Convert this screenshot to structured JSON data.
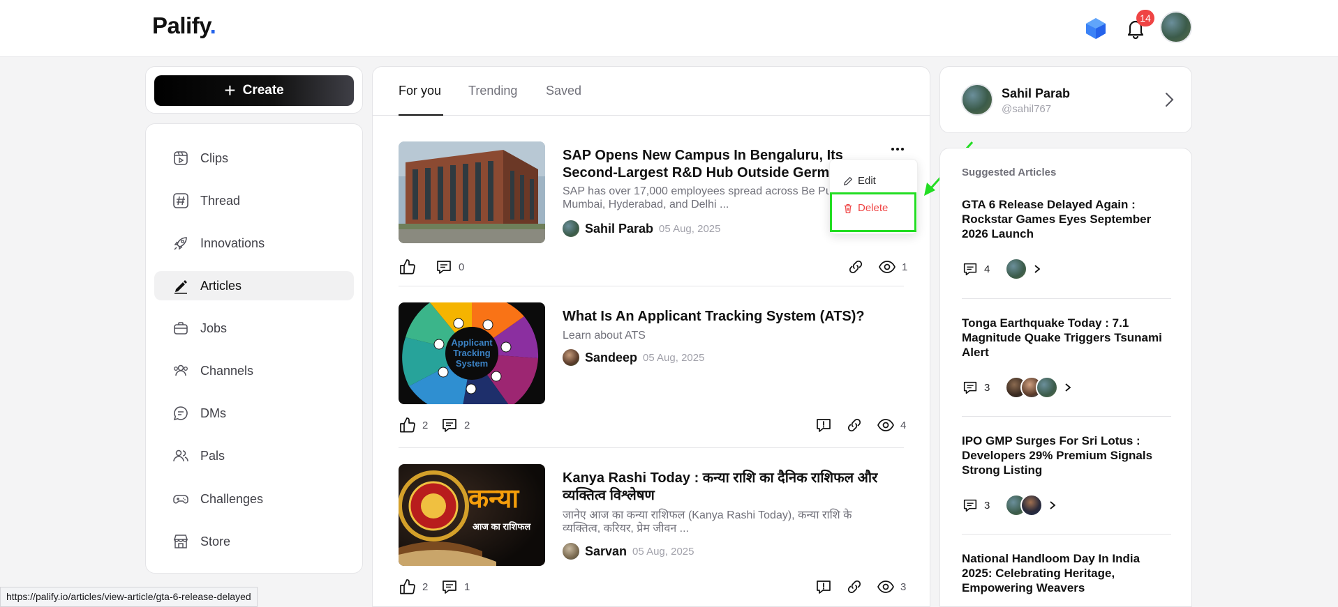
{
  "header": {
    "logo_text": "Palify",
    "logo_dot": ".",
    "notification_count": "14",
    "accent_color": "#2563eb"
  },
  "sidebar": {
    "create_label": "Create",
    "items": [
      {
        "label": "Clips",
        "icon": "clips-icon"
      },
      {
        "label": "Thread",
        "icon": "hash-icon"
      },
      {
        "label": "Innovations",
        "icon": "rocket-icon"
      },
      {
        "label": "Articles",
        "icon": "pen-icon",
        "active": true
      },
      {
        "label": "Jobs",
        "icon": "briefcase-icon"
      },
      {
        "label": "Channels",
        "icon": "users-icon"
      },
      {
        "label": "DMs",
        "icon": "chat-icon"
      },
      {
        "label": "Pals",
        "icon": "pals-icon"
      },
      {
        "label": "Challenges",
        "icon": "gamepad-icon"
      },
      {
        "label": "Store",
        "icon": "store-icon"
      }
    ]
  },
  "feed": {
    "tabs": [
      {
        "label": "For you",
        "active": true
      },
      {
        "label": "Trending"
      },
      {
        "label": "Saved"
      }
    ],
    "articles": [
      {
        "title": "SAP Opens New Campus In Bengaluru, Its Second-Largest R&D Hub Outside Germ",
        "description": "SAP has over 17,000 employees spread across Be Pune, Mumbai, Hyderabad, and Delhi ...",
        "author": "Sahil Parab",
        "date": "05 Aug, 2025",
        "likes": "",
        "comments": "0",
        "views": "1"
      },
      {
        "title": "What Is An Applicant Tracking System (ATS)?",
        "description": "Learn about ATS",
        "author": "Sandeep",
        "date": "05 Aug, 2025",
        "likes": "2",
        "comments": "2",
        "views": "4",
        "thumb_text": "Applicant Tracking System"
      },
      {
        "title": "Kanya Rashi Today : कन्या राशि का दैनिक राशिफल और व्यक्तित्व विश्लेषण",
        "description": "जानेए आज का कन्या राशिफल (Kanya Rashi Today), कन्या राशि के व्यक्तित्व, करियर, प्रेम जीवन ...",
        "author": "Sarvan",
        "date": "05 Aug, 2025",
        "likes": "2",
        "comments": "1",
        "views": "3",
        "thumb_text": "कन्या",
        "thumb_subtext": "आज का राशिफल"
      }
    ],
    "menu": {
      "edit": "Edit",
      "delete": "Delete",
      "delete_color": "#ef4444"
    }
  },
  "profile": {
    "name": "Sahil Parab",
    "handle": "@sahil767"
  },
  "suggested": {
    "heading": "Suggested Articles",
    "items": [
      {
        "title": "GTA 6 Release Delayed Again : Rockstar Games Eyes September 2026 Launch",
        "comments": "4"
      },
      {
        "title": "Tonga Earthquake Today : 7.1 Magnitude Quake Triggers Tsunami Alert",
        "comments": "3"
      },
      {
        "title": "IPO GMP Surges For Sri Lotus : Developers 29% Premium Signals Strong Listing",
        "comments": "3"
      },
      {
        "title": "National Handloom Day In India 2025: Celebrating Heritage, Empowering Weavers",
        "comments": ""
      }
    ]
  },
  "statusbar": {
    "url": "https://palify.io/articles/view-article/gta-6-release-delayed"
  }
}
